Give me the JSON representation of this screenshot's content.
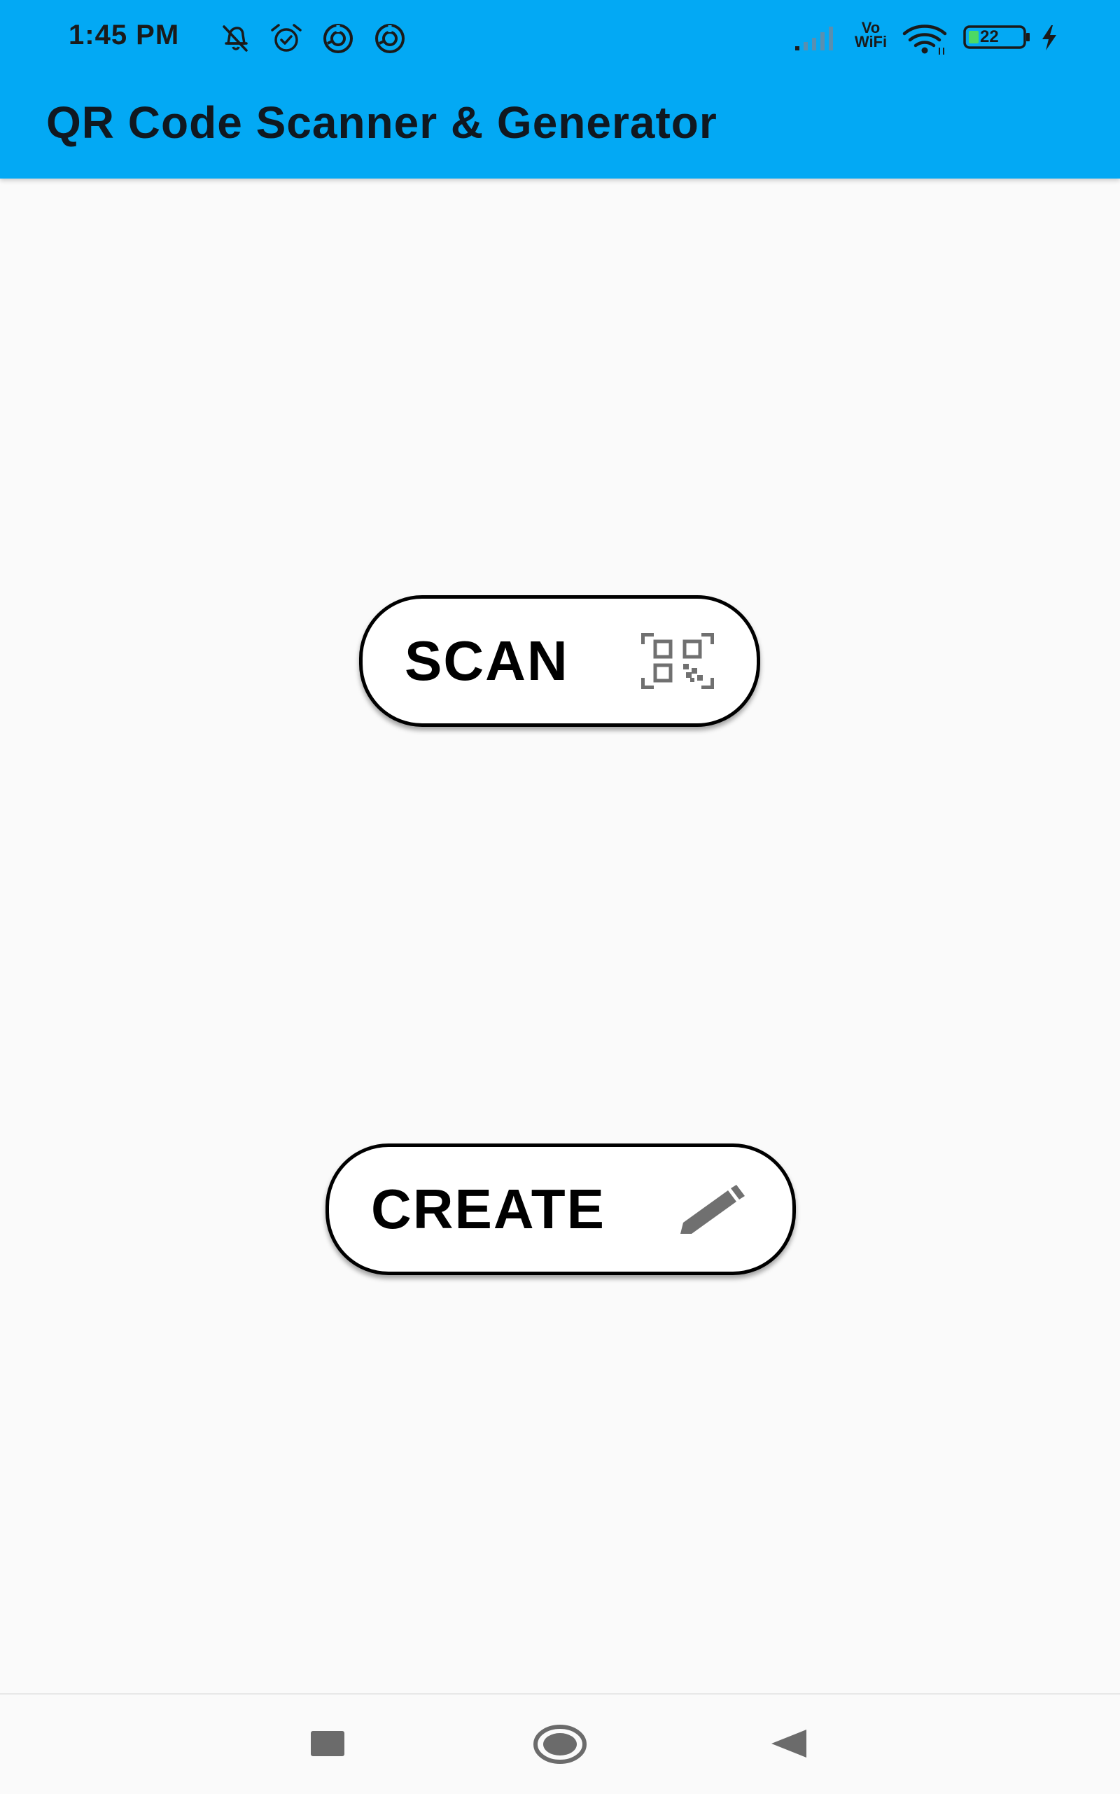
{
  "status_bar": {
    "time": "1:45 PM",
    "icons": [
      "notifications-off-icon",
      "alarm-icon",
      "data-saver-icon",
      "data-saver-icon",
      "signal-icon",
      "vowifi-icon",
      "wifi-icon",
      "battery-icon",
      "charging-icon"
    ],
    "vowifi_top": "Vo",
    "vowifi_bottom": "WiFi",
    "battery_level": "22"
  },
  "app_bar": {
    "title": "QR Code Scanner & Generator",
    "color": "#03a9f4"
  },
  "main": {
    "scan_button": {
      "label": "SCAN",
      "icon": "qr-code-icon"
    },
    "create_button": {
      "label": "CREATE",
      "icon": "pencil-icon"
    }
  },
  "nav_bar": {
    "icons": [
      "recents-square-icon",
      "home-circle-icon",
      "back-triangle-icon"
    ]
  }
}
